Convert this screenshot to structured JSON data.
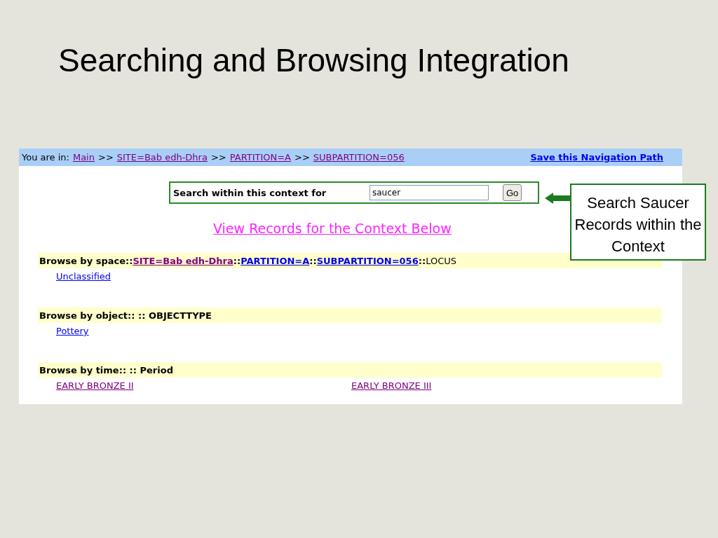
{
  "slide_title": "Searching and Browsing Integration",
  "breadcrumb": {
    "label": "You are in:",
    "separator": ">>",
    "links": [
      {
        "text": "Main",
        "visited": true
      },
      {
        "text": "SITE=Bab edh-Dhra",
        "visited": true
      },
      {
        "text": "PARTITION=A",
        "visited": true
      },
      {
        "text": "SUBPARTITION=056",
        "visited": true
      }
    ],
    "save_link": {
      "text": "Save this Navigation Path",
      "visited": false
    }
  },
  "search": {
    "label": "Search within this context for",
    "value": "saucer",
    "button": "Go"
  },
  "view_records_link": "View Records for the Context Below",
  "browse_sections": [
    {
      "heading": [
        {
          "kind": "label",
          "text": "Browse by space::"
        },
        {
          "kind": "link",
          "text": "SITE=Bab edh-Dhra",
          "visited": true
        },
        {
          "kind": "label",
          "text": "::"
        },
        {
          "kind": "link",
          "text": "PARTITION=A",
          "visited": false
        },
        {
          "kind": "label",
          "text": "::"
        },
        {
          "kind": "link",
          "text": "SUBPARTITION=056",
          "visited": false
        },
        {
          "kind": "label",
          "text": "::"
        },
        {
          "kind": "plain",
          "text": "LOCUS"
        }
      ],
      "items": [
        {
          "text": "Unclassified",
          "visited": false
        }
      ]
    },
    {
      "heading": [
        {
          "kind": "label",
          "text": "Browse by object:: :: OBJECTTYPE"
        }
      ],
      "items": [
        {
          "text": "Pottery",
          "visited": false
        }
      ]
    },
    {
      "heading": [
        {
          "kind": "label",
          "text": "Browse by time:: :: Period"
        }
      ],
      "items": [
        {
          "text": "EARLY BRONZE II",
          "visited": true
        },
        {
          "text": "EARLY BRONZE III",
          "visited": true
        }
      ]
    }
  ],
  "callout": "Search Saucer Records within the Context"
}
